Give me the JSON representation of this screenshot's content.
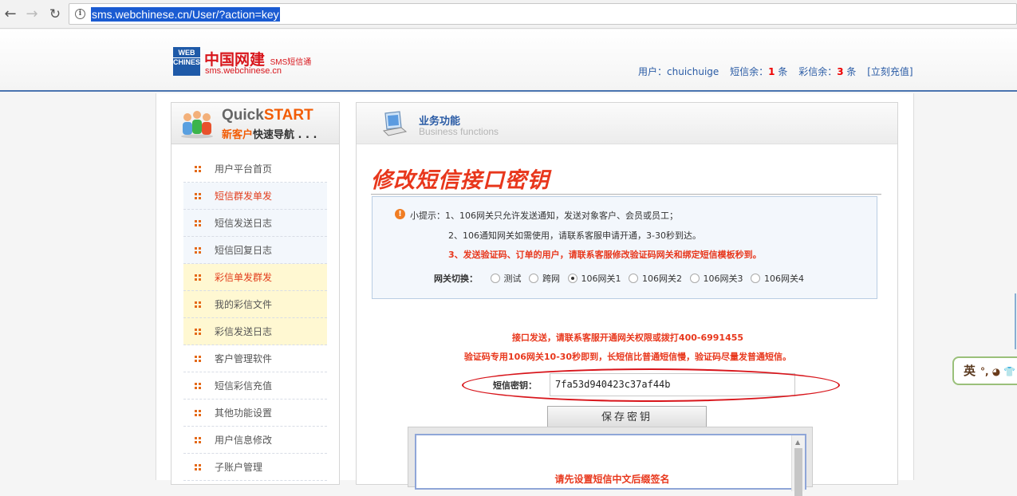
{
  "browser": {
    "url": "sms.webchinese.cn/User/?action=key"
  },
  "header": {
    "logo_box_top": "WEB",
    "logo_box_bottom": "CHINESE",
    "logo_title": "中国网建",
    "logo_sms": "SMS短信通",
    "logo_domain": "sms.webchinese.cn",
    "user_label": "用户：",
    "username": "chuichuige",
    "sms_label": "短信余：",
    "sms_count": "1",
    "sms_unit": "条",
    "mms_label": "彩信余：",
    "mms_count": "3",
    "mms_unit": "条",
    "recharge_link": "[立刻充值]"
  },
  "sidebar": {
    "quick": "Quick",
    "start": "START",
    "sub_orange": "新客户",
    "sub_dark": "快速导航 . . .",
    "items": [
      {
        "label": "用户平台首页"
      },
      {
        "label": "短信群发单发"
      },
      {
        "label": "短信发送日志"
      },
      {
        "label": "短信回复日志"
      },
      {
        "label": "彩信单发群发"
      },
      {
        "label": "我的彩信文件"
      },
      {
        "label": "彩信发送日志"
      },
      {
        "label": "客户管理软件"
      },
      {
        "label": "短信彩信充值"
      },
      {
        "label": "其他功能设置"
      },
      {
        "label": "用户信息修改"
      },
      {
        "label": "子账户管理"
      }
    ]
  },
  "main": {
    "title": "业务功能",
    "subtitle": "Business functions",
    "page_title": "修改短信接口密钥",
    "tips": {
      "line1": "小提示：1、106网关只允许发送通知，发送对象客户、会员或员工；",
      "line2": "2、106通知网关如需使用，请联系客服申请开通，3-30秒到达。",
      "line3": "3、发送验证码、订单的用户，请联系客服修改验证码网关和绑定短信模板秒到。",
      "gateway_label": "网关切换：",
      "gateway_options": [
        "测试",
        "跨网",
        "106网关1",
        "106网关2",
        "106网关3",
        "106网关4"
      ],
      "gateway_selected": "106网关1"
    },
    "notice1": "接口发送，请联系客服开通网关权限或拨打400-6991455",
    "notice2": "验证码专用106网关10-30秒即到，长短信比普通短信慢，验证码尽量发普通短信。",
    "key_label": "短信密钥：",
    "key_value": "7fa53d940423c37af44b",
    "save_button": "保存密钥",
    "sign_notice": "请先设置短信中文后缀签名"
  },
  "ime": {
    "label": "英",
    "extra": "°, ◕ 👕"
  }
}
